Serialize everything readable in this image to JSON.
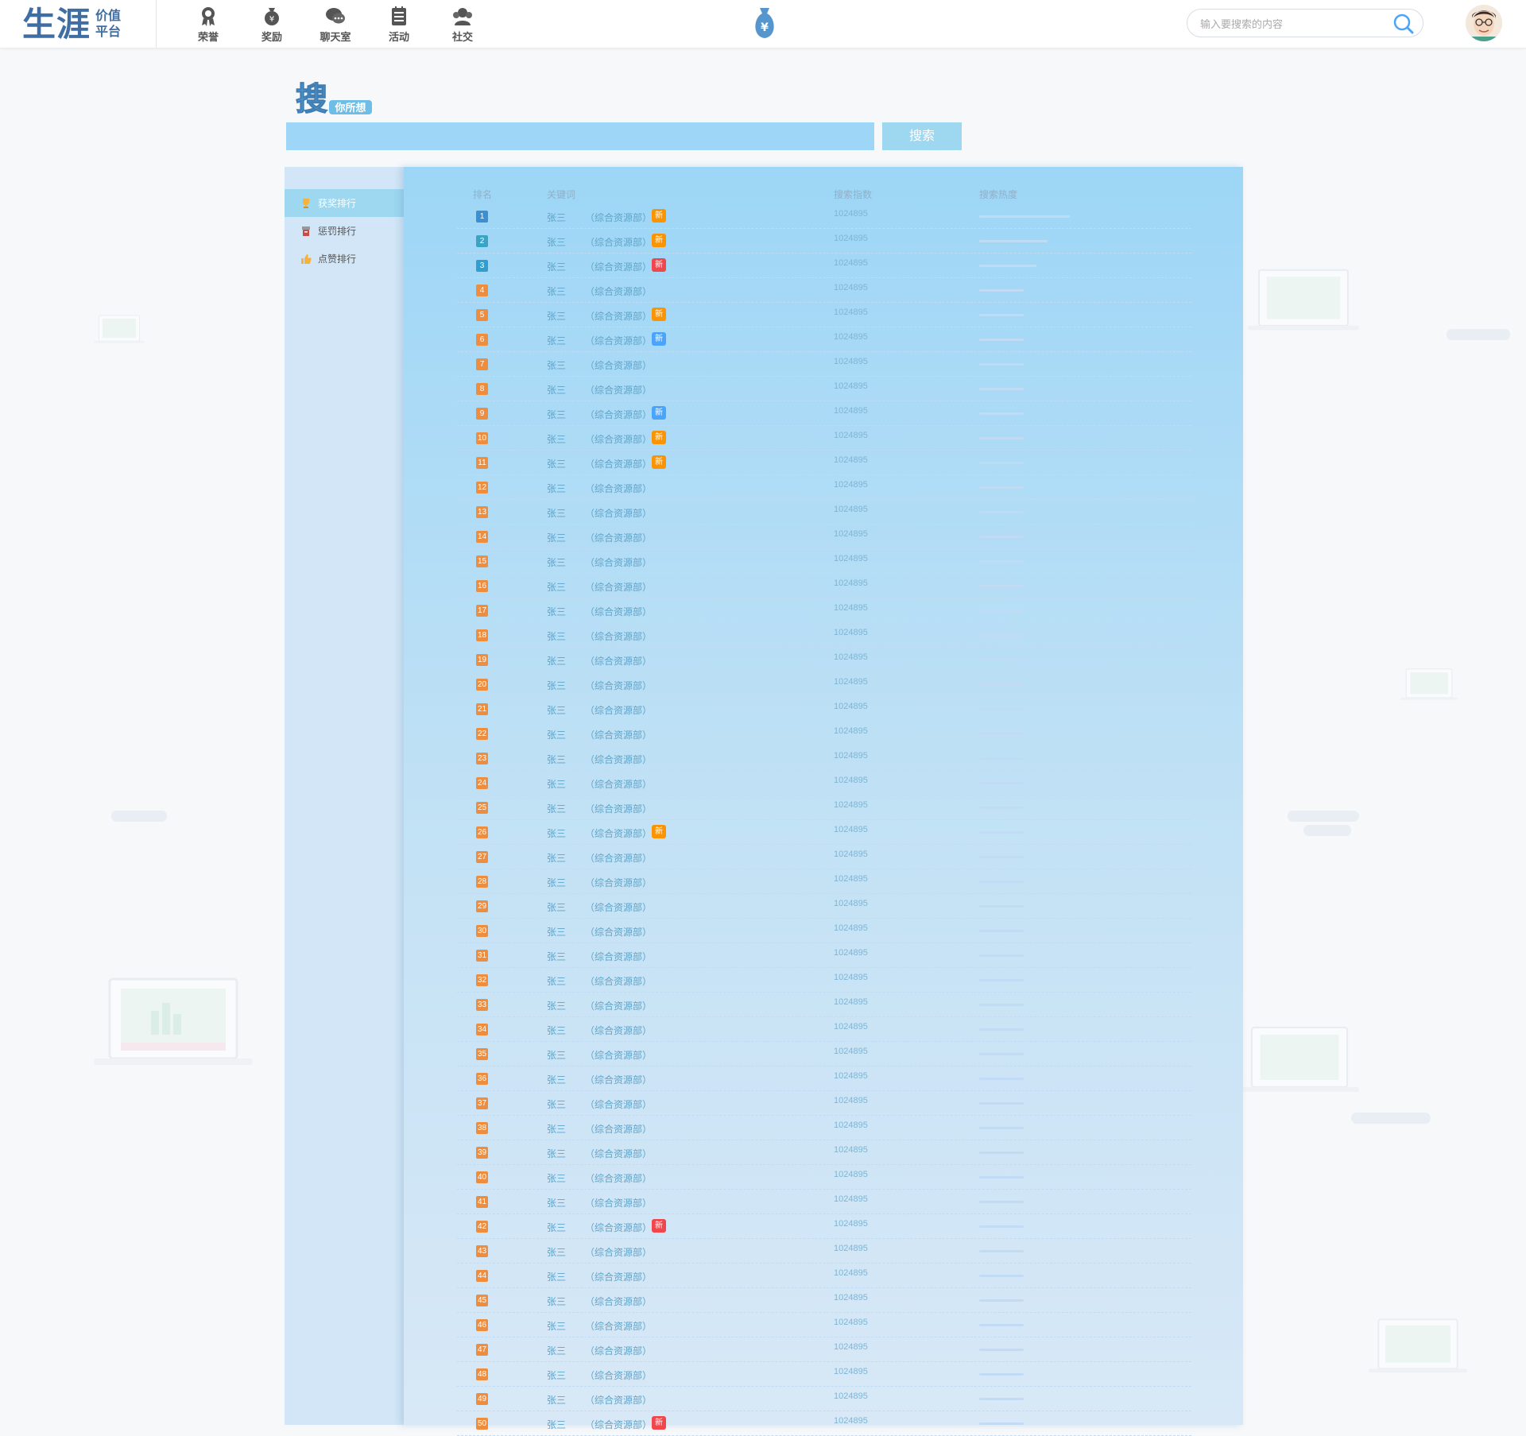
{
  "logo": {
    "main": "生涯",
    "sub1": "价值",
    "sub2": "平台"
  },
  "nav": [
    {
      "label": "荣誉",
      "icon": "medal-icon"
    },
    {
      "label": "奖励",
      "icon": "reward-bag-icon"
    },
    {
      "label": "聊天室",
      "icon": "chat-bubble-icon"
    },
    {
      "label": "活动",
      "icon": "calendar-list-icon"
    },
    {
      "label": "社交",
      "icon": "people-icon"
    }
  ],
  "center_icon": "money-bag-icon",
  "search": {
    "placeholder": "输入要搜索的内容"
  },
  "brand": {
    "big": "搜",
    "small": "你所想"
  },
  "keyword_search": {
    "button": "搜索"
  },
  "sidebar": {
    "items": [
      {
        "label": "获奖排行",
        "icon": "trophy-icon",
        "active": true
      },
      {
        "label": "惩罚排行",
        "icon": "penalty-icon",
        "active": false
      },
      {
        "label": "点赞排行",
        "icon": "thumb-up-icon",
        "active": false
      }
    ]
  },
  "table": {
    "headers": {
      "rank": "排名",
      "keyword": "关键词",
      "index": "搜索指数",
      "heat": "搜索热度"
    },
    "rows": [
      {
        "rank": "1",
        "name": "张三",
        "dept": "（综合资源部）",
        "badge": "新",
        "badge_color": "orange",
        "index": "1024895",
        "heat": 0.95
      },
      {
        "rank": "2",
        "name": "张三",
        "dept": "（综合资源部）",
        "badge": "新",
        "badge_color": "orange",
        "index": "1024895",
        "heat": 0.72
      },
      {
        "rank": "3",
        "name": "张三",
        "dept": "（综合资源部）",
        "badge": "新",
        "badge_color": "red",
        "index": "1024895",
        "heat": 0.6
      },
      {
        "rank": "4",
        "name": "张三",
        "dept": "（综合资源部）",
        "badge": "",
        "badge_color": "",
        "index": "1024895",
        "heat": 0.47
      },
      {
        "rank": "5",
        "name": "张三",
        "dept": "（综合资源部）",
        "badge": "新",
        "badge_color": "orange",
        "index": "1024895",
        "heat": 0.47
      },
      {
        "rank": "6",
        "name": "张三",
        "dept": "（综合资源部）",
        "badge": "新",
        "badge_color": "blue",
        "index": "1024895",
        "heat": 0.47
      },
      {
        "rank": "7",
        "name": "张三",
        "dept": "（综合资源部）",
        "badge": "",
        "badge_color": "",
        "index": "1024895",
        "heat": 0.47
      },
      {
        "rank": "8",
        "name": "张三",
        "dept": "（综合资源部）",
        "badge": "",
        "badge_color": "",
        "index": "1024895",
        "heat": 0.47
      },
      {
        "rank": "9",
        "name": "张三",
        "dept": "（综合资源部）",
        "badge": "新",
        "badge_color": "blue",
        "index": "1024895",
        "heat": 0.47
      },
      {
        "rank": "10",
        "name": "张三",
        "dept": "（综合资源部）",
        "badge": "新",
        "badge_color": "orange",
        "index": "1024895",
        "heat": 0.47
      },
      {
        "rank": "11",
        "name": "张三",
        "dept": "（综合资源部）",
        "badge": "新",
        "badge_color": "orange",
        "index": "1024895",
        "heat": 0.47
      },
      {
        "rank": "12",
        "name": "张三",
        "dept": "（综合资源部）",
        "badge": "",
        "badge_color": "",
        "index": "1024895",
        "heat": 0.47
      },
      {
        "rank": "13",
        "name": "张三",
        "dept": "（综合资源部）",
        "badge": "",
        "badge_color": "",
        "index": "1024895",
        "heat": 0.47
      },
      {
        "rank": "14",
        "name": "张三",
        "dept": "（综合资源部）",
        "badge": "",
        "badge_color": "",
        "index": "1024895",
        "heat": 0.47
      },
      {
        "rank": "15",
        "name": "张三",
        "dept": "（综合资源部）",
        "badge": "",
        "badge_color": "",
        "index": "1024895",
        "heat": 0.47
      },
      {
        "rank": "16",
        "name": "张三",
        "dept": "（综合资源部）",
        "badge": "",
        "badge_color": "",
        "index": "1024895",
        "heat": 0.47
      },
      {
        "rank": "17",
        "name": "张三",
        "dept": "（综合资源部）",
        "badge": "",
        "badge_color": "",
        "index": "1024895",
        "heat": 0.47
      },
      {
        "rank": "18",
        "name": "张三",
        "dept": "（综合资源部）",
        "badge": "",
        "badge_color": "",
        "index": "1024895",
        "heat": 0.47
      },
      {
        "rank": "19",
        "name": "张三",
        "dept": "（综合资源部）",
        "badge": "",
        "badge_color": "",
        "index": "1024895",
        "heat": 0.47
      },
      {
        "rank": "20",
        "name": "张三",
        "dept": "（综合资源部）",
        "badge": "",
        "badge_color": "",
        "index": "1024895",
        "heat": 0.47
      },
      {
        "rank": "21",
        "name": "张三",
        "dept": "（综合资源部）",
        "badge": "",
        "badge_color": "",
        "index": "1024895",
        "heat": 0.47
      },
      {
        "rank": "22",
        "name": "张三",
        "dept": "（综合资源部）",
        "badge": "",
        "badge_color": "",
        "index": "1024895",
        "heat": 0.47
      },
      {
        "rank": "23",
        "name": "张三",
        "dept": "（综合资源部）",
        "badge": "",
        "badge_color": "",
        "index": "1024895",
        "heat": 0.47
      },
      {
        "rank": "24",
        "name": "张三",
        "dept": "（综合资源部）",
        "badge": "",
        "badge_color": "",
        "index": "1024895",
        "heat": 0.47
      },
      {
        "rank": "25",
        "name": "张三",
        "dept": "（综合资源部）",
        "badge": "",
        "badge_color": "",
        "index": "1024895",
        "heat": 0.47
      },
      {
        "rank": "26",
        "name": "张三",
        "dept": "（综合资源部）",
        "badge": "新",
        "badge_color": "orange",
        "index": "1024895",
        "heat": 0.47
      },
      {
        "rank": "27",
        "name": "张三",
        "dept": "（综合资源部）",
        "badge": "",
        "badge_color": "",
        "index": "1024895",
        "heat": 0.47
      },
      {
        "rank": "28",
        "name": "张三",
        "dept": "（综合资源部）",
        "badge": "",
        "badge_color": "",
        "index": "1024895",
        "heat": 0.47
      },
      {
        "rank": "29",
        "name": "张三",
        "dept": "（综合资源部）",
        "badge": "",
        "badge_color": "",
        "index": "1024895",
        "heat": 0.47
      },
      {
        "rank": "30",
        "name": "张三",
        "dept": "（综合资源部）",
        "badge": "",
        "badge_color": "",
        "index": "1024895",
        "heat": 0.47
      },
      {
        "rank": "31",
        "name": "张三",
        "dept": "（综合资源部）",
        "badge": "",
        "badge_color": "",
        "index": "1024895",
        "heat": 0.47
      },
      {
        "rank": "32",
        "name": "张三",
        "dept": "（综合资源部）",
        "badge": "",
        "badge_color": "",
        "index": "1024895",
        "heat": 0.47
      },
      {
        "rank": "33",
        "name": "张三",
        "dept": "（综合资源部）",
        "badge": "",
        "badge_color": "",
        "index": "1024895",
        "heat": 0.47
      },
      {
        "rank": "34",
        "name": "张三",
        "dept": "（综合资源部）",
        "badge": "",
        "badge_color": "",
        "index": "1024895",
        "heat": 0.47
      },
      {
        "rank": "35",
        "name": "张三",
        "dept": "（综合资源部）",
        "badge": "",
        "badge_color": "",
        "index": "1024895",
        "heat": 0.47
      },
      {
        "rank": "36",
        "name": "张三",
        "dept": "（综合资源部）",
        "badge": "",
        "badge_color": "",
        "index": "1024895",
        "heat": 0.47
      },
      {
        "rank": "37",
        "name": "张三",
        "dept": "（综合资源部）",
        "badge": "",
        "badge_color": "",
        "index": "1024895",
        "heat": 0.47
      },
      {
        "rank": "38",
        "name": "张三",
        "dept": "（综合资源部）",
        "badge": "",
        "badge_color": "",
        "index": "1024895",
        "heat": 0.47
      },
      {
        "rank": "39",
        "name": "张三",
        "dept": "（综合资源部）",
        "badge": "",
        "badge_color": "",
        "index": "1024895",
        "heat": 0.47
      },
      {
        "rank": "40",
        "name": "张三",
        "dept": "（综合资源部）",
        "badge": "",
        "badge_color": "",
        "index": "1024895",
        "heat": 0.47
      },
      {
        "rank": "41",
        "name": "张三",
        "dept": "（综合资源部）",
        "badge": "",
        "badge_color": "",
        "index": "1024895",
        "heat": 0.47
      },
      {
        "rank": "42",
        "name": "张三",
        "dept": "（综合资源部）",
        "badge": "新",
        "badge_color": "red",
        "index": "1024895",
        "heat": 0.47
      },
      {
        "rank": "43",
        "name": "张三",
        "dept": "（综合资源部）",
        "badge": "",
        "badge_color": "",
        "index": "1024895",
        "heat": 0.47
      },
      {
        "rank": "44",
        "name": "张三",
        "dept": "（综合资源部）",
        "badge": "",
        "badge_color": "",
        "index": "1024895",
        "heat": 0.47
      },
      {
        "rank": "45",
        "name": "张三",
        "dept": "（综合资源部）",
        "badge": "",
        "badge_color": "",
        "index": "1024895",
        "heat": 0.47
      },
      {
        "rank": "46",
        "name": "张三",
        "dept": "（综合资源部）",
        "badge": "",
        "badge_color": "",
        "index": "1024895",
        "heat": 0.47
      },
      {
        "rank": "47",
        "name": "张三",
        "dept": "（综合资源部）",
        "badge": "",
        "badge_color": "",
        "index": "1024895",
        "heat": 0.47
      },
      {
        "rank": "48",
        "name": "张三",
        "dept": "（综合资源部）",
        "badge": "",
        "badge_color": "",
        "index": "1024895",
        "heat": 0.47
      },
      {
        "rank": "49",
        "name": "张三",
        "dept": "（综合资源部）",
        "badge": "",
        "badge_color": "",
        "index": "1024895",
        "heat": 0.47
      },
      {
        "rank": "50",
        "name": "张三",
        "dept": "（综合资源部）",
        "badge": "新",
        "badge_color": "red",
        "index": "1024895",
        "heat": 0.47
      }
    ]
  },
  "colors": {
    "search_bar": "#9dd6f6",
    "search_button": "#9dd7f0",
    "sidebar": "#d2e6f7",
    "active_tab": "#9dd7f0",
    "badge_orange": "#fc9300",
    "badge_red": "#f2464d",
    "badge_blue": "#4ba4fb",
    "dashed_line": "#c2dbf4",
    "index_text": "#60a4c8"
  }
}
